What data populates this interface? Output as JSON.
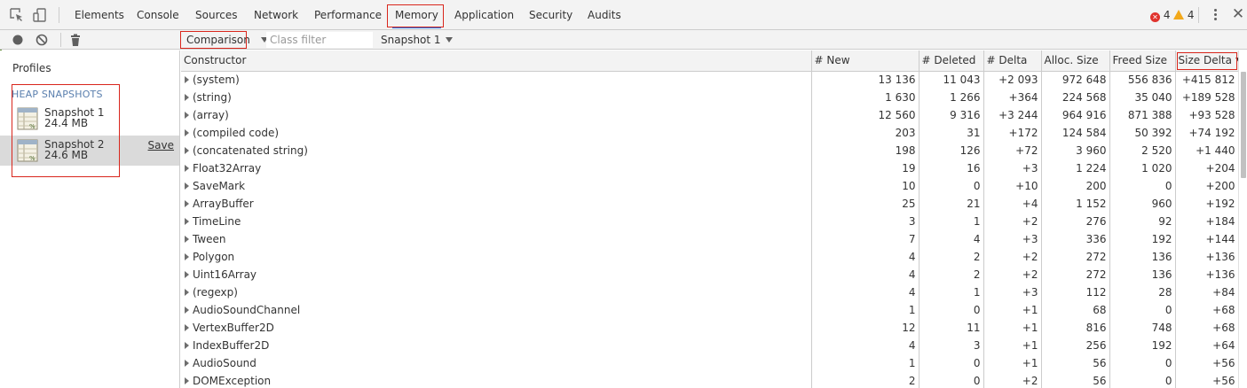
{
  "tabs": [
    {
      "label": "Elements"
    },
    {
      "label": "Console"
    },
    {
      "label": "Sources"
    },
    {
      "label": "Network"
    },
    {
      "label": "Performance"
    },
    {
      "label": "Memory"
    },
    {
      "label": "Application"
    },
    {
      "label": "Security"
    },
    {
      "label": "Audits"
    }
  ],
  "status": {
    "errors": "4",
    "warnings": "4"
  },
  "toolbar": {
    "view_mode": "Comparison",
    "filter_placeholder": "Class filter",
    "base_snapshot": "Snapshot 1"
  },
  "sidebar": {
    "title": "Profiles",
    "section": "HEAP SNAPSHOTS",
    "snapshots": [
      {
        "name": "Snapshot 1",
        "size": "24.4 MB"
      },
      {
        "name": "Snapshot 2",
        "size": "24.6 MB",
        "action": "Save"
      }
    ]
  },
  "table": {
    "headers": [
      "Constructor",
      "# New",
      "# Deleted",
      "# Delta",
      "Alloc. Size",
      "Freed Size",
      "Size Delta"
    ],
    "rows": [
      [
        "(system)",
        "13 136",
        "11 043",
        "+2 093",
        "972 648",
        "556 836",
        "+415 812"
      ],
      [
        "(string)",
        "1 630",
        "1 266",
        "+364",
        "224 568",
        "35 040",
        "+189 528"
      ],
      [
        "(array)",
        "12 560",
        "9 316",
        "+3 244",
        "964 916",
        "871 388",
        "+93 528"
      ],
      [
        "(compiled code)",
        "203",
        "31",
        "+172",
        "124 584",
        "50 392",
        "+74 192"
      ],
      [
        "(concatenated string)",
        "198",
        "126",
        "+72",
        "3 960",
        "2 520",
        "+1 440"
      ],
      [
        "Float32Array",
        "19",
        "16",
        "+3",
        "1 224",
        "1 020",
        "+204"
      ],
      [
        "SaveMark",
        "10",
        "0",
        "+10",
        "200",
        "0",
        "+200"
      ],
      [
        "ArrayBuffer",
        "25",
        "21",
        "+4",
        "1 152",
        "960",
        "+192"
      ],
      [
        "TimeLine",
        "3",
        "1",
        "+2",
        "276",
        "92",
        "+184"
      ],
      [
        "Tween",
        "7",
        "4",
        "+3",
        "336",
        "192",
        "+144"
      ],
      [
        "Polygon",
        "4",
        "2",
        "+2",
        "272",
        "136",
        "+136"
      ],
      [
        "Uint16Array",
        "4",
        "2",
        "+2",
        "272",
        "136",
        "+136"
      ],
      [
        "(regexp)",
        "4",
        "1",
        "+3",
        "112",
        "28",
        "+84"
      ],
      [
        "AudioSoundChannel",
        "1",
        "0",
        "+1",
        "68",
        "0",
        "+68"
      ],
      [
        "VertexBuffer2D",
        "12",
        "11",
        "+1",
        "816",
        "748",
        "+68"
      ],
      [
        "IndexBuffer2D",
        "4",
        "3",
        "+1",
        "256",
        "192",
        "+64"
      ],
      [
        "AudioSound",
        "1",
        "0",
        "+1",
        "56",
        "0",
        "+56"
      ],
      [
        "DOMException",
        "2",
        "0",
        "+2",
        "56",
        "0",
        "+56"
      ]
    ]
  }
}
